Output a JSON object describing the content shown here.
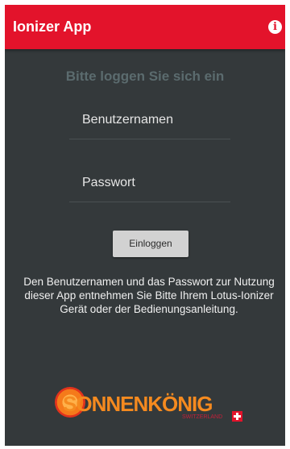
{
  "appbar": {
    "title": "Ionizer App",
    "info_icon": "info-icon",
    "color": "#e3132b"
  },
  "login": {
    "heading": "Bitte loggen Sie sich ein",
    "username_placeholder": "Benutzernamen",
    "password_placeholder": "Passwort",
    "button_label": "Einloggen",
    "hint": "Den Benutzernamen und das Passwort zur Nutzung dieser App entnehmen Sie Bitte Ihrem Lotus-Ionizer Gerät oder der Bedienungsanleitung."
  },
  "logo": {
    "text": "SONNENKÖNIG",
    "tagline": "SWITZERLAND",
    "flag_icon": "swiss-cross-icon"
  },
  "colors": {
    "background": "#34393b",
    "accent": "#e3132b",
    "logo_orange": "#f58a1f"
  }
}
